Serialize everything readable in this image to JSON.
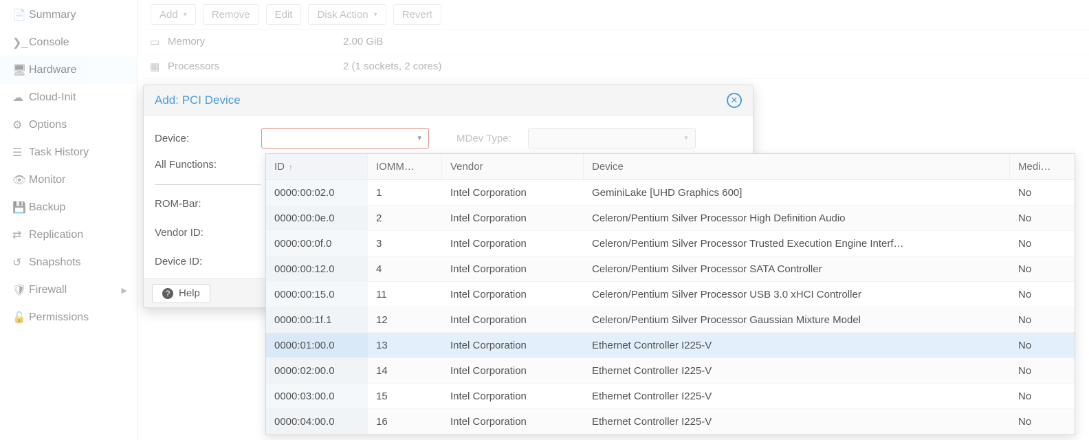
{
  "sidebar": {
    "items": [
      {
        "icon": "📄",
        "label": "Summary",
        "name": "sidebar-item-summary"
      },
      {
        "icon": "❯_",
        "label": "Console",
        "name": "sidebar-item-console"
      },
      {
        "icon": "🖥",
        "label": "Hardware",
        "name": "sidebar-item-hardware",
        "selected": true
      },
      {
        "icon": "☁",
        "label": "Cloud-Init",
        "name": "sidebar-item-cloud-init"
      },
      {
        "icon": "⚙",
        "label": "Options",
        "name": "sidebar-item-options"
      },
      {
        "icon": "☰",
        "label": "Task History",
        "name": "sidebar-item-task-history"
      },
      {
        "icon": "👁",
        "label": "Monitor",
        "name": "sidebar-item-monitor"
      },
      {
        "icon": "💾",
        "label": "Backup",
        "name": "sidebar-item-backup"
      },
      {
        "icon": "⇄",
        "label": "Replication",
        "name": "sidebar-item-replication"
      },
      {
        "icon": "↺",
        "label": "Snapshots",
        "name": "sidebar-item-snapshots"
      },
      {
        "icon": "🛡",
        "label": "Firewall",
        "name": "sidebar-item-firewall",
        "hasSub": true
      },
      {
        "icon": "🔓",
        "label": "Permissions",
        "name": "sidebar-item-permissions"
      }
    ]
  },
  "toolbar": {
    "add": "Add",
    "remove": "Remove",
    "edit": "Edit",
    "diskAction": "Disk Action",
    "revert": "Revert"
  },
  "hardware_rows": [
    {
      "icon": "▭",
      "label": "Memory",
      "value": "2.00 GiB"
    },
    {
      "icon": "▦",
      "label": "Processors",
      "value": "2 (1 sockets, 2 cores)"
    }
  ],
  "modal": {
    "title": "Add: PCI Device",
    "labels": {
      "device": "Device:",
      "allFunctions": "All Functions:",
      "romBar": "ROM-Bar:",
      "vendorId": "Vendor ID:",
      "deviceId": "Device ID:",
      "mdevType": "MDev Type:",
      "help": "Help"
    }
  },
  "dropdown": {
    "columns": {
      "id": "ID",
      "iommu": "IOMM…",
      "vendor": "Vendor",
      "device": "Device",
      "mediated": "Medi…"
    },
    "rows": [
      {
        "id": "0000:00:02.0",
        "iommu": "1",
        "vendor": "Intel Corporation",
        "device": "GeminiLake [UHD Graphics 600]",
        "med": "No"
      },
      {
        "id": "0000:00:0e.0",
        "iommu": "2",
        "vendor": "Intel Corporation",
        "device": "Celeron/Pentium Silver Processor High Definition Audio",
        "med": "No"
      },
      {
        "id": "0000:00:0f.0",
        "iommu": "3",
        "vendor": "Intel Corporation",
        "device": "Celeron/Pentium Silver Processor Trusted Execution Engine Interf…",
        "med": "No"
      },
      {
        "id": "0000:00:12.0",
        "iommu": "4",
        "vendor": "Intel Corporation",
        "device": "Celeron/Pentium Silver Processor SATA Controller",
        "med": "No"
      },
      {
        "id": "0000:00:15.0",
        "iommu": "11",
        "vendor": "Intel Corporation",
        "device": "Celeron/Pentium Silver Processor USB 3.0 xHCI Controller",
        "med": "No"
      },
      {
        "id": "0000:00:1f.1",
        "iommu": "12",
        "vendor": "Intel Corporation",
        "device": "Celeron/Pentium Silver Processor Gaussian Mixture Model",
        "med": "No"
      },
      {
        "id": "0000:01:00.0",
        "iommu": "13",
        "vendor": "Intel Corporation",
        "device": "Ethernet Controller I225-V",
        "med": "No",
        "highlight": true
      },
      {
        "id": "0000:02:00.0",
        "iommu": "14",
        "vendor": "Intel Corporation",
        "device": "Ethernet Controller I225-V",
        "med": "No"
      },
      {
        "id": "0000:03:00.0",
        "iommu": "15",
        "vendor": "Intel Corporation",
        "device": "Ethernet Controller I225-V",
        "med": "No"
      },
      {
        "id": "0000:04:00.0",
        "iommu": "16",
        "vendor": "Intel Corporation",
        "device": "Ethernet Controller I225-V",
        "med": "No"
      }
    ]
  }
}
